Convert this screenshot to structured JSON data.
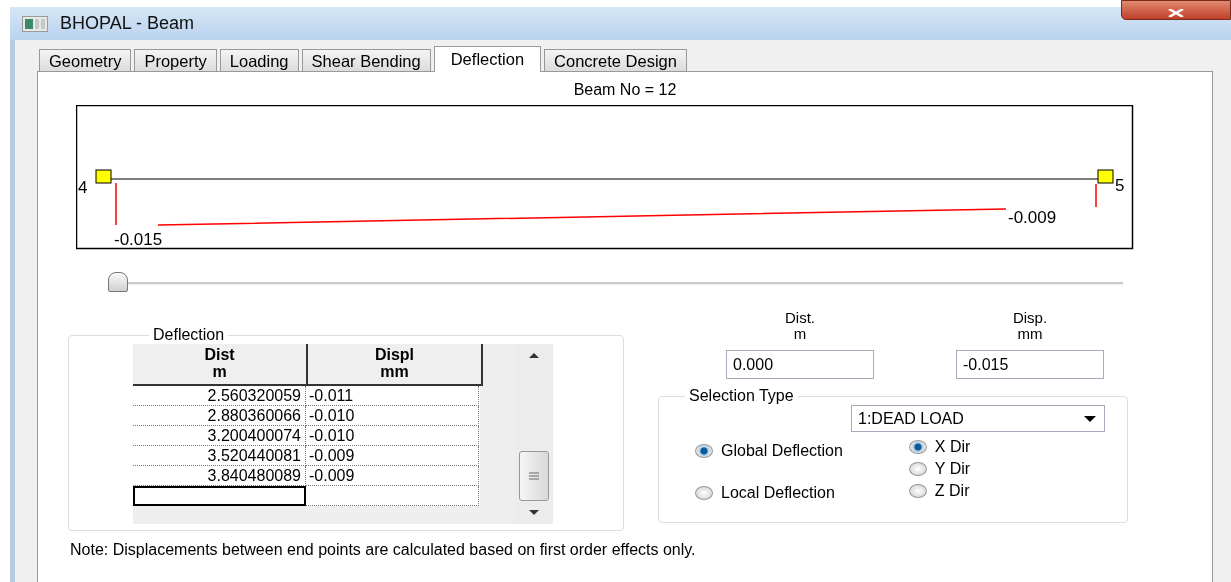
{
  "window": {
    "title": "BHOPAL - Beam"
  },
  "tabs": [
    {
      "label": "Geometry",
      "selected": false
    },
    {
      "label": "Property",
      "selected": false
    },
    {
      "label": "Loading",
      "selected": false
    },
    {
      "label": "Shear Bending",
      "selected": false
    },
    {
      "label": "Deflection",
      "selected": true
    },
    {
      "label": "Concrete Design",
      "selected": false
    }
  ],
  "beam_label": "Beam No = 12",
  "diagram": {
    "start_node": "4",
    "end_node": "5",
    "start_value": "-0.015",
    "end_value": "-0.009"
  },
  "position_slider": {
    "level": 0
  },
  "deflection_group": {
    "title": "Deflection",
    "columns": [
      {
        "lines": [
          "Dist",
          "m"
        ]
      },
      {
        "lines": [
          "Displ",
          "mm"
        ]
      }
    ],
    "rows": [
      [
        "2.560320059",
        "-0.011"
      ],
      [
        "2.880360066",
        "-0.010"
      ],
      [
        "3.200400074",
        "-0.010"
      ],
      [
        "3.520440081",
        "-0.009"
      ],
      [
        "3.840480089",
        "-0.009"
      ]
    ]
  },
  "dist_field": {
    "label_lines": [
      "Dist.",
      "m"
    ],
    "value": "0.000"
  },
  "disp_field": {
    "label_lines": [
      "Disp.",
      "mm"
    ],
    "value": "-0.015"
  },
  "selection_type": {
    "title": "Selection Type",
    "load_case": "1:DEAD LOAD",
    "deflection_types": [
      {
        "label": "Global Deflection",
        "selected": true
      },
      {
        "label": "Local Deflection",
        "selected": false
      }
    ],
    "directions": [
      {
        "label": "X Dir",
        "selected": true
      },
      {
        "label": "Y Dir",
        "selected": false
      },
      {
        "label": "Z Dir",
        "selected": false
      }
    ]
  },
  "note": "Note: Displacements between end points are calculated based on first order effects only."
}
